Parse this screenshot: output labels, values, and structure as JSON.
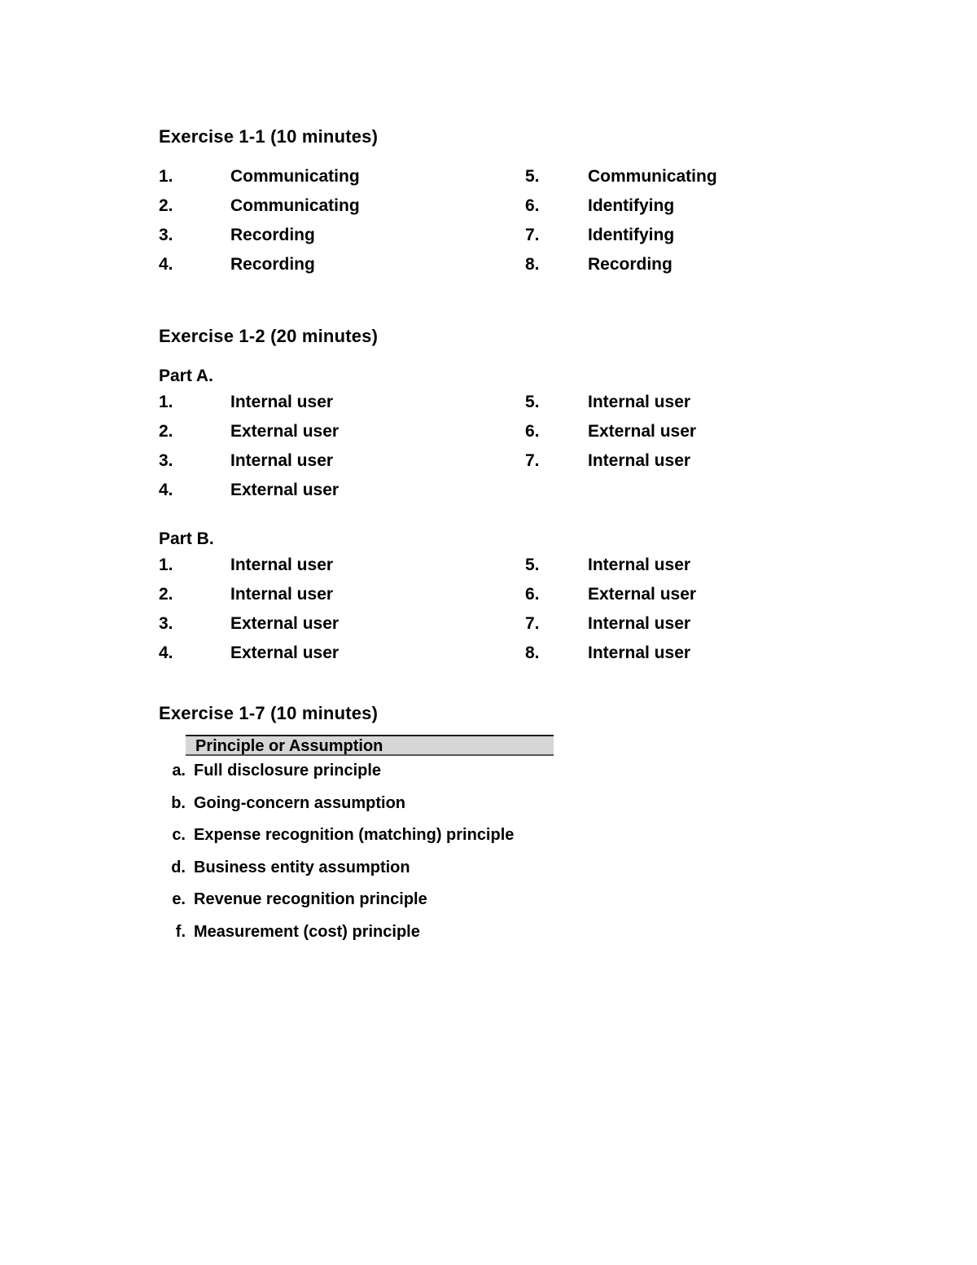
{
  "document": {
    "type": "worksheet-answer-key",
    "page_background": "#ffffff",
    "text_color": "#000000",
    "table_header_fill": "#d6d6d6"
  },
  "sections": [
    {
      "id": "exercise-1-1",
      "heading": "Exercise 1-1 (10 minutes)",
      "left_column": [
        {
          "num": "1.",
          "value": "Communicating"
        },
        {
          "num": "2.",
          "value": "Communicating"
        },
        {
          "num": "3.",
          "value": "Recording"
        },
        {
          "num": "4.",
          "value": "Recording"
        }
      ],
      "right_column": [
        {
          "num": "5.",
          "value": "Communicating"
        },
        {
          "num": "6.",
          "value": "Identifying"
        },
        {
          "num": "7.",
          "value": "Identifying"
        },
        {
          "num": "8.",
          "value": "Recording"
        }
      ]
    },
    {
      "id": "exercise-1-2",
      "heading": "Exercise 1-2 (20 minutes)",
      "parts": [
        {
          "id": "part-a",
          "label": "Part A.",
          "left_column": [
            {
              "num": "1.",
              "value": "Internal user"
            },
            {
              "num": "2.",
              "value": "External user"
            },
            {
              "num": "3.",
              "value": "Internal user"
            },
            {
              "num": "4.",
              "value": "External user"
            }
          ],
          "right_column": [
            {
              "num": "5.",
              "value": "Internal user"
            },
            {
              "num": "6.",
              "value": "External user"
            },
            {
              "num": "7.",
              "value": "Internal user"
            }
          ]
        },
        {
          "id": "part-b",
          "label": "Part B.",
          "left_column": [
            {
              "num": "1.",
              "value": "Internal user"
            },
            {
              "num": "2.",
              "value": "Internal user"
            },
            {
              "num": "3.",
              "value": "External user"
            },
            {
              "num": "4.",
              "value": "External user"
            }
          ],
          "right_column": [
            {
              "num": "5.",
              "value": "Internal user"
            },
            {
              "num": "6.",
              "value": "External user"
            },
            {
              "num": "7.",
              "value": "Internal user"
            },
            {
              "num": "8.",
              "value": "Internal user"
            }
          ]
        }
      ]
    },
    {
      "id": "exercise-1-7",
      "heading": "Exercise 1-7 (10 minutes)",
      "table": {
        "column_header": "Principle or Assumption",
        "rows": [
          {
            "mark": "a.",
            "text": "Full disclosure principle"
          },
          {
            "mark": "b.",
            "text": "Going-concern assumption"
          },
          {
            "mark": "c.",
            "text": "Expense recognition (matching) principle"
          },
          {
            "mark": "d.",
            "text": "Business entity assumption"
          },
          {
            "mark": "e.",
            "text": "Revenue recognition principle"
          },
          {
            "mark": "f.",
            "text": "Measurement (cost) principle"
          }
        ]
      }
    }
  ]
}
